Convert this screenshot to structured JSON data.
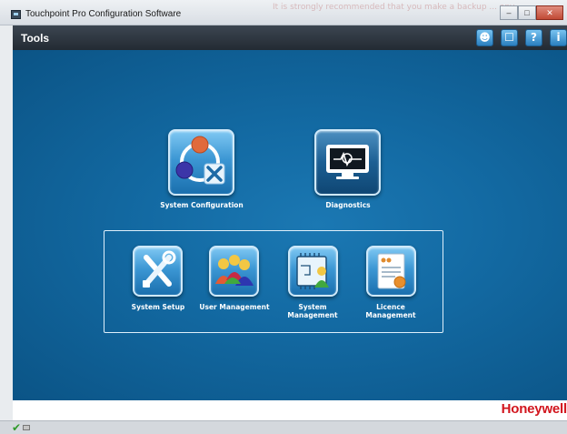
{
  "window": {
    "title": "Touchpoint Pro Configuration Software",
    "background_notice": "It is strongly recommended that you make a backup ... any changes to"
  },
  "window_controls": {
    "minimize": "–",
    "maximize": "□",
    "close": "✕"
  },
  "toolbar": {
    "label": "Tools",
    "icons": [
      {
        "name": "user-icon",
        "glyph": "☻"
      },
      {
        "name": "unlock-icon",
        "glyph": "☐"
      },
      {
        "name": "help-icon",
        "glyph": "?"
      },
      {
        "name": "info-icon",
        "glyph": "i"
      }
    ]
  },
  "tiles": {
    "system_configuration": "System Configuration",
    "diagnostics": "Diagnostics",
    "system_setup": "System Setup",
    "user_management": "User Management",
    "system_management": "System Management",
    "licence_management": "Licence Management"
  },
  "footer": {
    "brand": "Honeywell"
  },
  "status": {
    "ok_glyph": "✔"
  },
  "colors": {
    "panel": "#136aa3",
    "toolbar": "#2f3841",
    "brand": "#d2161e",
    "tile_highlight": "#7fc8f3"
  }
}
